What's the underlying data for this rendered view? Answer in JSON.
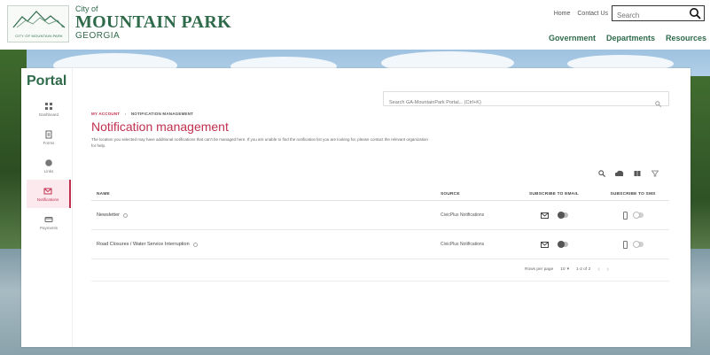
{
  "header": {
    "logo_text": "CITY OF MOUNTAIN PARK",
    "city_of": "City of",
    "city_name": "MOUNTAIN PARK",
    "state": "GEORGIA",
    "top_links": [
      "Home",
      "Contact Us"
    ],
    "search_placeholder": "Search",
    "nav": [
      "Government",
      "Departments",
      "Resources"
    ]
  },
  "portal": {
    "title": "Portal",
    "side_nav": [
      {
        "label": "Dashboard",
        "icon": "grid-icon",
        "active": false
      },
      {
        "label": "Forms",
        "icon": "form-icon",
        "active": false
      },
      {
        "label": "Links",
        "icon": "globe-icon",
        "active": false
      },
      {
        "label": "Notifications",
        "icon": "mail-icon",
        "active": true
      },
      {
        "label": "Payments",
        "icon": "card-icon",
        "active": false
      }
    ],
    "site_search_placeholder": "Search GA-MountainPark Portal... (Ctrl+K)"
  },
  "breadcrumb": {
    "first": "MY ACCOUNT",
    "current": "NOTIFICATION MANAGEMENT"
  },
  "page": {
    "title": "Notification management",
    "description": "The location you selected may have additional notifications that can't be managed here. If you are unable to find the notification list you are looking for, please contact the relevant organization for help."
  },
  "table": {
    "headers": {
      "name": "NAME",
      "source": "SOURCE",
      "email": "SUBSCRIBE TO EMAIL",
      "sms": "SUBSCRIBE TO SMS"
    },
    "rows": [
      {
        "name": "Newsletter",
        "source": "CivicPlus Notifications"
      },
      {
        "name": "Road Closures / Water Service Interruption",
        "source": "CivicPlus Notifications"
      }
    ]
  },
  "pager": {
    "rows_label": "Rows per page",
    "rows_value": "10",
    "range": "1-2 of 2"
  },
  "colors": {
    "brand_green": "#2f6b4b",
    "accent_red": "#c0304e"
  }
}
